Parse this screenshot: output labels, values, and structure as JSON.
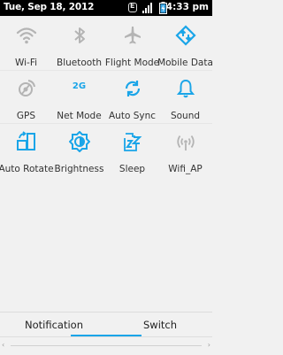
{
  "status_bar": {
    "date": "Tue, Sep 18, 2012",
    "network_badge": "E",
    "time": "4:33 pm"
  },
  "toggles": [
    {
      "label": "Wi-Fi",
      "icon": "wifi-icon",
      "state": "off"
    },
    {
      "label": "Bluetooth",
      "icon": "bluetooth-icon",
      "state": "off"
    },
    {
      "label": "Flight Mode",
      "icon": "airplane-icon",
      "state": "off"
    },
    {
      "label": "Mobile Data",
      "icon": "mobile-data-icon",
      "state": "on"
    },
    {
      "label": "GPS",
      "icon": "gps-icon",
      "state": "off"
    },
    {
      "label": "Net Mode",
      "icon_text": "2G",
      "icon": "net-mode-icon",
      "state": "on"
    },
    {
      "label": "Auto Sync",
      "icon": "sync-icon",
      "state": "on"
    },
    {
      "label": "Sound",
      "icon": "bell-icon",
      "state": "on"
    },
    {
      "label": "Auto Rotate",
      "icon": "rotate-icon",
      "state": "on"
    },
    {
      "label": "Brightness",
      "icon": "brightness-icon",
      "state": "on"
    },
    {
      "label": "Sleep",
      "icon": "sleep-icon",
      "state": "on"
    },
    {
      "label": "Wifi_AP",
      "icon": "wifi-ap-icon",
      "state": "off"
    }
  ],
  "tabs": [
    {
      "label": "Notification",
      "selected": false
    },
    {
      "label": "Switch",
      "selected": true
    }
  ],
  "colors": {
    "accent": "#1aa5e8",
    "inactive_icon": "#b4b4b4",
    "background": "#f1f1f1"
  }
}
